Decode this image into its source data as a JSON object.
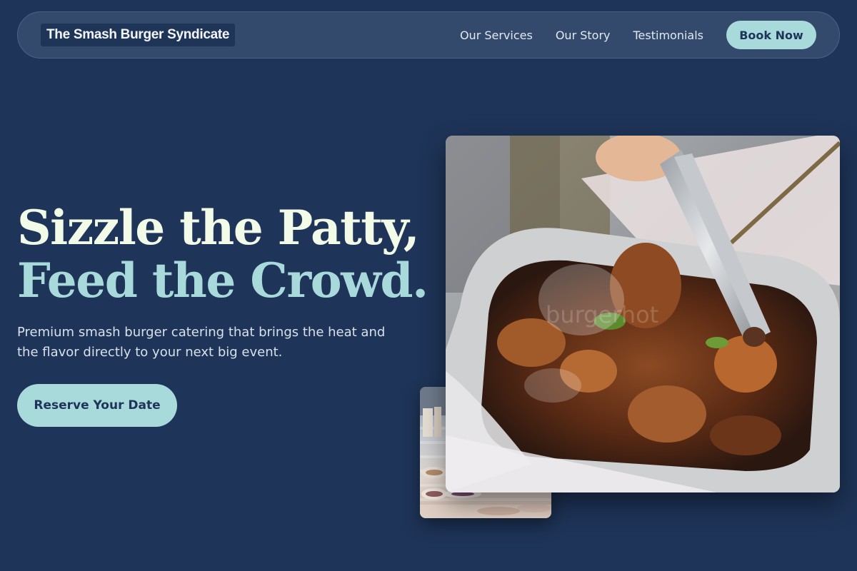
{
  "nav": {
    "brand": "The Smash Burger Syndicate",
    "links": [
      "Our Services",
      "Our Story",
      "Testimonials"
    ],
    "cta": "Book Now"
  },
  "hero": {
    "headline_line1": "Sizzle the Patty,",
    "headline_line2": "Feed the Crowd.",
    "subtext": "Premium smash burger catering that brings the heat and the flavor directly to your next big event.",
    "cta": "Reserve Your Date"
  },
  "images": {
    "main_watermark": "burgerhot"
  },
  "colors": {
    "background": "#1e3458",
    "nav_background": "#334a6d",
    "accent": "#a8dadc",
    "headline_primary": "#f2fae8"
  }
}
